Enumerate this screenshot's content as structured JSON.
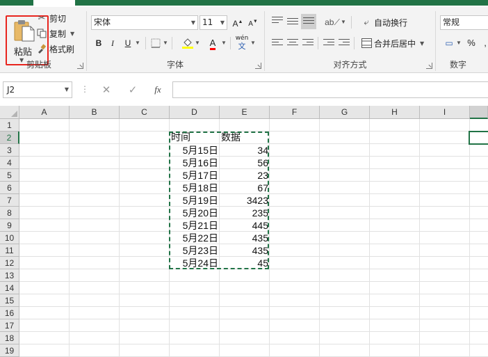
{
  "ribbon": {
    "clipboard": {
      "group_label": "剪贴板",
      "paste_label": "粘贴",
      "cut_label": "剪切",
      "copy_label": "复制",
      "format_painter_label": "格式刷"
    },
    "font": {
      "group_label": "字体",
      "font_name": "宋体",
      "font_size": "11",
      "bold": "B",
      "italic": "I",
      "underline": "U",
      "phonetic": "wén",
      "fill_color": "#ffff00",
      "font_color": "#ff0000"
    },
    "alignment": {
      "group_label": "对齐方式",
      "wrap_text_label": "自动换行",
      "merge_center_label": "合并后居中"
    },
    "number": {
      "group_label": "数字",
      "format_value": "常规",
      "percent": "%"
    }
  },
  "formula_bar": {
    "name_box": "J2",
    "fx": "fx",
    "formula": ""
  },
  "sheet": {
    "columns": [
      "A",
      "B",
      "C",
      "D",
      "E",
      "F",
      "G",
      "H",
      "I"
    ],
    "rows": [
      "1",
      "2",
      "3",
      "4",
      "5",
      "6",
      "7",
      "8",
      "9",
      "10",
      "11",
      "12",
      "13",
      "14",
      "15",
      "16",
      "17",
      "18",
      "19"
    ],
    "header": {
      "D": "时间",
      "E": "数据"
    },
    "data": [
      {
        "date": "5月15日",
        "value": "34"
      },
      {
        "date": "5月16日",
        "value": "56"
      },
      {
        "date": "5月17日",
        "value": "23"
      },
      {
        "date": "5月18日",
        "value": "67"
      },
      {
        "date": "5月19日",
        "value": "3423"
      },
      {
        "date": "5月20日",
        "value": "235"
      },
      {
        "date": "5月21日",
        "value": "445"
      },
      {
        "date": "5月22日",
        "value": "435"
      },
      {
        "date": "5月23日",
        "value": "435"
      },
      {
        "date": "5月24日",
        "value": "45"
      }
    ],
    "accent_color": "#217346"
  }
}
